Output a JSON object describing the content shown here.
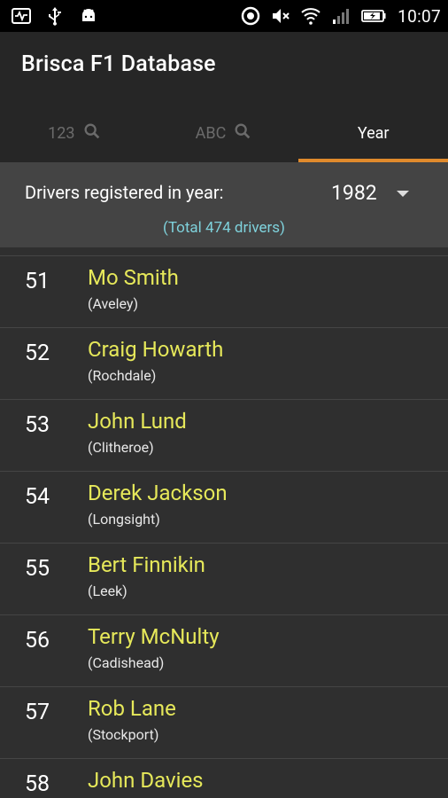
{
  "status_bar": {
    "time": "10:07",
    "icons_left": [
      "activity-icon",
      "usb-icon",
      "android-icon"
    ],
    "icons_right": [
      "sync-icon",
      "mute-icon",
      "wifi-icon",
      "signal-icon",
      "battery-icon"
    ]
  },
  "app": {
    "title": "Brisca F1 Database"
  },
  "tabs": [
    {
      "label": "123",
      "icon": "search-icon",
      "active": false
    },
    {
      "label": "ABC",
      "icon": "search-icon",
      "active": false
    },
    {
      "label": "Year",
      "active": true
    }
  ],
  "filter": {
    "label": "Drivers registered in year:",
    "year": "1982",
    "total": "(Total 474 drivers)"
  },
  "drivers": [
    {
      "num": "51",
      "name": "Mo Smith",
      "town": "(Aveley)"
    },
    {
      "num": "52",
      "name": "Craig Howarth",
      "town": "(Rochdale)"
    },
    {
      "num": "53",
      "name": "John Lund",
      "town": "(Clitheroe)"
    },
    {
      "num": "54",
      "name": "Derek Jackson",
      "town": "(Longsight)"
    },
    {
      "num": "55",
      "name": "Bert Finnikin",
      "town": "(Leek)"
    },
    {
      "num": "56",
      "name": "Terry McNulty",
      "town": "(Cadishead)"
    },
    {
      "num": "57",
      "name": "Rob Lane",
      "town": "(Stockport)"
    },
    {
      "num": "58",
      "name": "John Davies",
      "town": ""
    }
  ],
  "colors": {
    "accent": "#e08a2c",
    "name": "#e6e85a",
    "total": "#7fd2dc"
  }
}
